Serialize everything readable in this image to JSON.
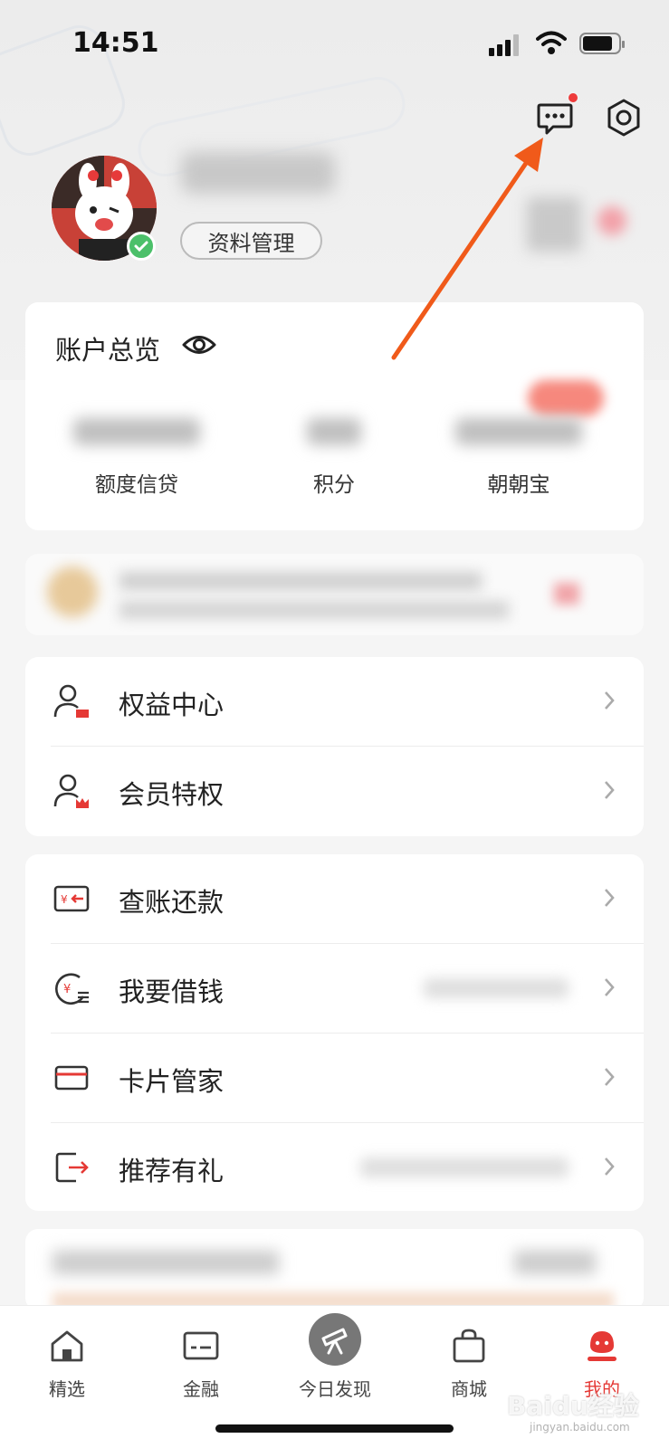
{
  "status_bar": {
    "time": "14:51"
  },
  "profile": {
    "manage_button": "资料管理"
  },
  "account_overview": {
    "title": "账户总览",
    "items": [
      {
        "label": "额度信贷"
      },
      {
        "label": "积分"
      },
      {
        "label": "朝朝宝"
      }
    ]
  },
  "menu_group_1": [
    {
      "label": "权益中心",
      "icon": "user-card-icon"
    },
    {
      "label": "会员特权",
      "icon": "user-crown-icon"
    }
  ],
  "menu_group_2": [
    {
      "label": "查账还款",
      "icon": "bill-repay-icon"
    },
    {
      "label": "我要借钱",
      "icon": "borrow-money-icon"
    },
    {
      "label": "卡片管家",
      "icon": "card-icon"
    },
    {
      "label": "推荐有礼",
      "icon": "share-exit-icon"
    }
  ],
  "tab_bar": {
    "tabs": [
      {
        "label": "精选",
        "icon": "home-icon",
        "active": false
      },
      {
        "label": "金融",
        "icon": "wallet-icon",
        "active": false
      },
      {
        "label": "今日发现",
        "icon": "telescope-icon",
        "active": false
      },
      {
        "label": "商城",
        "icon": "shopping-bag-icon",
        "active": false
      },
      {
        "label": "我的",
        "icon": "profile-icon",
        "active": true
      }
    ]
  },
  "watermark": {
    "brand": "Baidu经验",
    "url": "jingyan.baidu.com"
  },
  "colors": {
    "accent": "#e53935",
    "annotation_arrow": "#f05a1a",
    "verified": "#4cc06a"
  }
}
